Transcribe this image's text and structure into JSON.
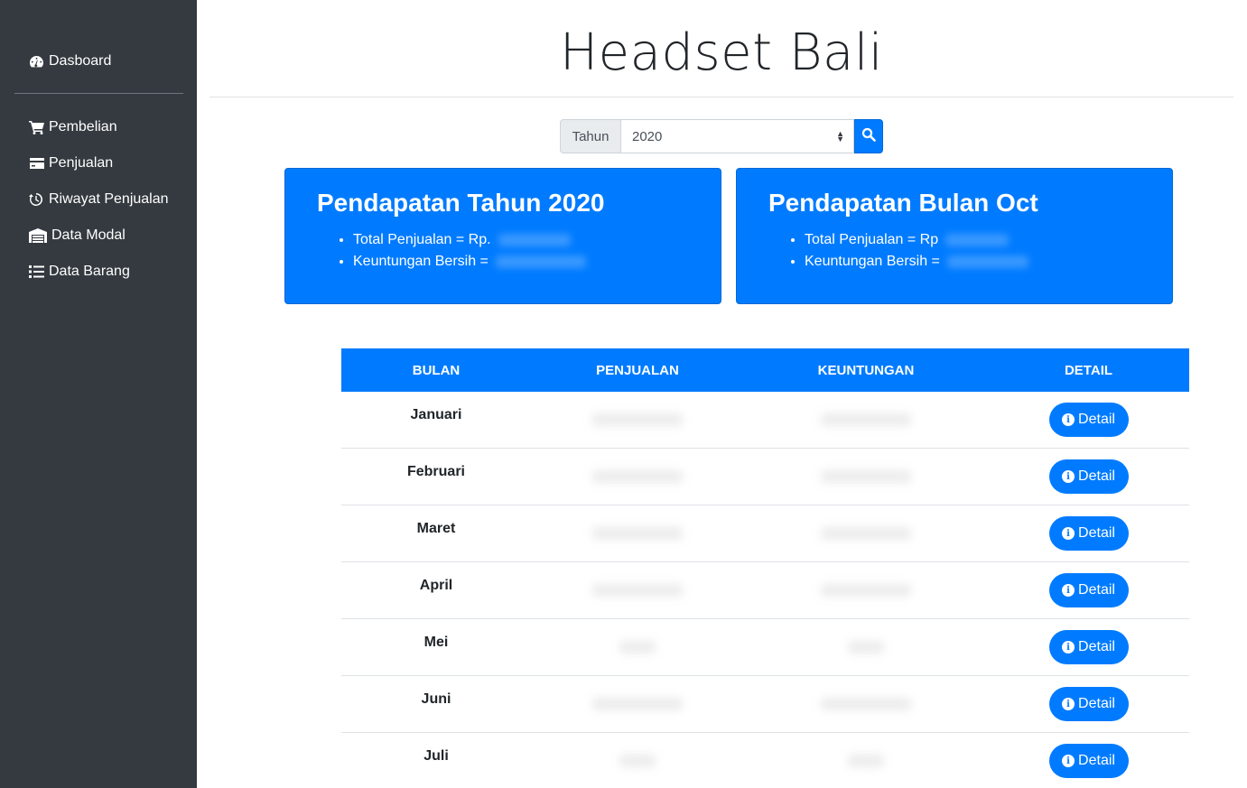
{
  "sidebar": {
    "items": [
      {
        "label": "Dasboard",
        "icon": "tachometer-icon"
      },
      {
        "label": "Pembelian",
        "icon": "shopping-cart-icon"
      },
      {
        "label": "Penjualan",
        "icon": "credit-card-icon"
      },
      {
        "label": "Riwayat Penjualan",
        "icon": "history-icon"
      },
      {
        "label": "Data Modal",
        "icon": "warehouse-icon"
      },
      {
        "label": "Data Barang",
        "icon": "list-icon"
      }
    ]
  },
  "header": {
    "title": "Headset Bali"
  },
  "filter": {
    "prefix": "Tahun",
    "selected": "2020"
  },
  "cards": [
    {
      "title": "Pendapatan Tahun 2020",
      "items": [
        "Total Penjualan = Rp.",
        "Keuntungan Bersih ="
      ]
    },
    {
      "title": "Pendapatan Bulan Oct",
      "items": [
        "Total Penjualan = Rp",
        "Keuntungan Bersih ="
      ]
    }
  ],
  "table": {
    "headers": [
      "BULAN",
      "PENJUALAN",
      "KEUNTUNGAN",
      "DETAIL"
    ],
    "rows": [
      {
        "month": "Januari",
        "button": "Detail"
      },
      {
        "month": "Februari",
        "button": "Detail"
      },
      {
        "month": "Maret",
        "button": "Detail"
      },
      {
        "month": "April",
        "button": "Detail"
      },
      {
        "month": "Mei",
        "button": "Detail"
      },
      {
        "month": "Juni",
        "button": "Detail"
      },
      {
        "month": "Juli",
        "button": "Detail"
      }
    ]
  },
  "colors": {
    "sidebar": "#343a40",
    "accent": "#007bff"
  }
}
